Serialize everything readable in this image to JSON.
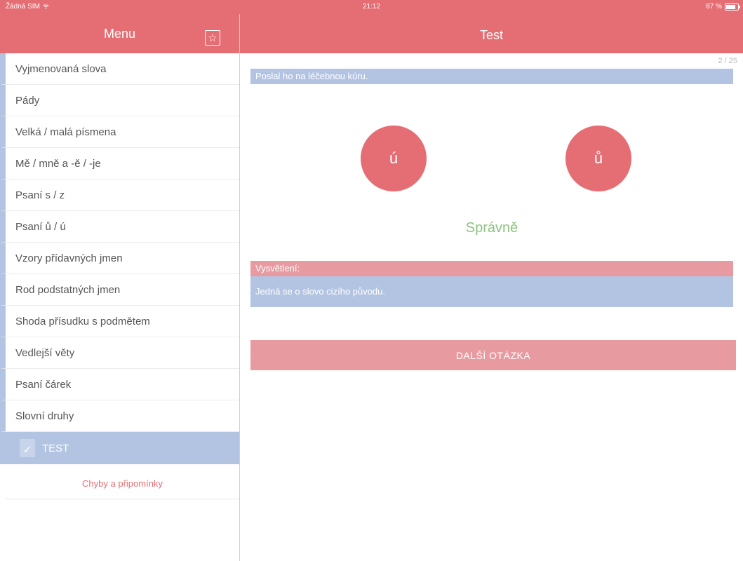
{
  "status_bar": {
    "carrier": "Žádná SIM",
    "time": "21:12",
    "battery": "87 %",
    "wifi_icon": "wifi-icon",
    "battery_icon": "battery-icon"
  },
  "sidebar": {
    "title": "Menu",
    "favorites_icon": "star-icon",
    "items": [
      {
        "label": "Vyjmenovaná slova"
      },
      {
        "label": "Pády"
      },
      {
        "label": "Velká / malá písmena"
      },
      {
        "label": "Mě / mně a -ě / -je"
      },
      {
        "label": "Psaní s / z"
      },
      {
        "label": "Psaní ů / ú"
      },
      {
        "label": "Vzory přídavných jmen"
      },
      {
        "label": "Rod podstatných jmen"
      },
      {
        "label": "Shoda přísudku s podmětem"
      },
      {
        "label": "Vedlejší věty"
      },
      {
        "label": "Psaní čárek"
      },
      {
        "label": "Slovní druhy"
      }
    ],
    "active_item": {
      "label": "TEST",
      "icon": "checkbox-icon"
    },
    "feedback_link": "Chyby a připomínky"
  },
  "main": {
    "title": "Test",
    "progress": "2 / 25",
    "question": "Poslal ho na léčebnou kúru.",
    "options": [
      {
        "label": "ú"
      },
      {
        "label": "ů"
      }
    ],
    "result": "Správně",
    "explanation_label": "Vysvětlení:",
    "explanation_text": "Jedná se o slovo cizího původu.",
    "next_button": "DALŠÍ OTÁZKA"
  },
  "colors": {
    "accent_red": "#e56d74",
    "light_red": "#e79ba0",
    "accent_blue": "#b3c4e2",
    "success_green": "#8cc37f"
  }
}
